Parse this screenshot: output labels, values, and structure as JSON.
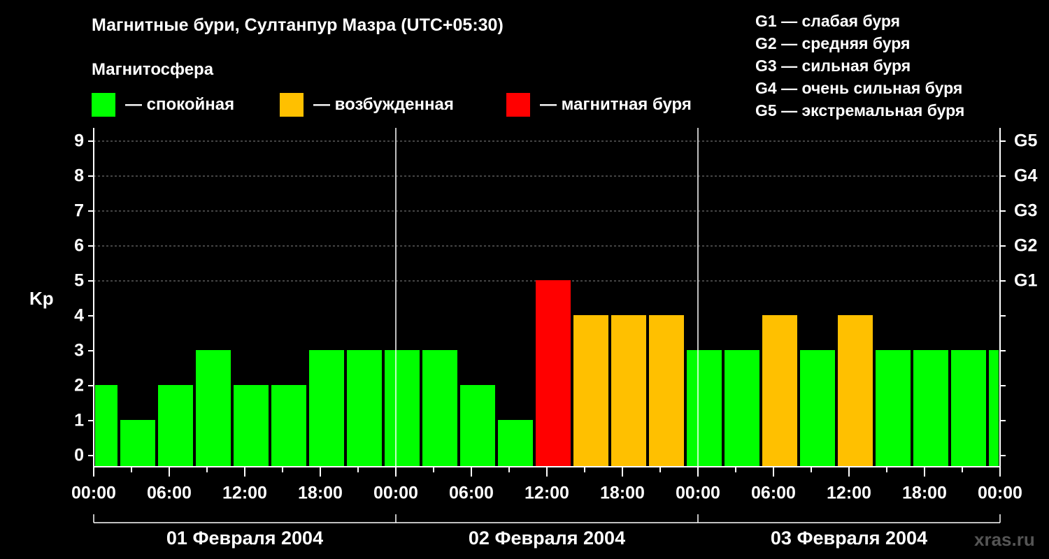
{
  "title": "Магнитные бури, Султанпур Мазра (UTC+05:30)",
  "subtitle": "Магнитосфера",
  "legend": [
    {
      "label": "— спокойная",
      "color": "#00ff00"
    },
    {
      "label": "— возбужденная",
      "color": "#ffc000"
    },
    {
      "label": "— магнитная буря",
      "color": "#ff0000"
    }
  ],
  "g_legend": [
    "G1 — слабая буря",
    "G2 — средняя буря",
    "G3 — сильная буря",
    "G4 — очень сильная буря",
    "G5 — экстремальная буря"
  ],
  "watermark": "xras.ru",
  "chart_data": {
    "type": "bar",
    "ylabel": "Kp",
    "ylim": [
      0,
      9
    ],
    "y_ticks": [
      "0",
      "1",
      "2",
      "3",
      "4",
      "5",
      "6",
      "7",
      "8",
      "9"
    ],
    "g_ticks": [
      {
        "kp": 5,
        "label": "G1"
      },
      {
        "kp": 6,
        "label": "G2"
      },
      {
        "kp": 7,
        "label": "G3"
      },
      {
        "kp": 8,
        "label": "G4"
      },
      {
        "kp": 9,
        "label": "G5"
      }
    ],
    "x_tick_labels": [
      "00:00",
      "06:00",
      "12:00",
      "18:00",
      "00:00",
      "06:00",
      "12:00",
      "18:00",
      "00:00",
      "06:00",
      "12:00",
      "18:00",
      "00:00"
    ],
    "days": [
      "01 Февраля 2004",
      "02 Февраля 2004",
      "03 Февраля 2004"
    ],
    "grid": true,
    "colors": {
      "quiet": "#00ff00",
      "active": "#ffc000",
      "storm": "#ff0000"
    },
    "bars": [
      {
        "start_hour": 0.0,
        "end_hour": 2.0,
        "kp": 2
      },
      {
        "start_hour": 2.0,
        "end_hour": 5.0,
        "kp": 1
      },
      {
        "start_hour": 5.0,
        "end_hour": 8.0,
        "kp": 2
      },
      {
        "start_hour": 8.0,
        "end_hour": 11.0,
        "kp": 3
      },
      {
        "start_hour": 11.0,
        "end_hour": 14.0,
        "kp": 2
      },
      {
        "start_hour": 14.0,
        "end_hour": 17.0,
        "kp": 2
      },
      {
        "start_hour": 17.0,
        "end_hour": 20.0,
        "kp": 3
      },
      {
        "start_hour": 20.0,
        "end_hour": 23.0,
        "kp": 3
      },
      {
        "start_hour": 23.0,
        "end_hour": 26.0,
        "kp": 3
      },
      {
        "start_hour": 26.0,
        "end_hour": 29.0,
        "kp": 3
      },
      {
        "start_hour": 29.0,
        "end_hour": 32.0,
        "kp": 2
      },
      {
        "start_hour": 32.0,
        "end_hour": 35.0,
        "kp": 1
      },
      {
        "start_hour": 35.0,
        "end_hour": 38.0,
        "kp": 5
      },
      {
        "start_hour": 38.0,
        "end_hour": 41.0,
        "kp": 4
      },
      {
        "start_hour": 41.0,
        "end_hour": 44.0,
        "kp": 4
      },
      {
        "start_hour": 44.0,
        "end_hour": 47.0,
        "kp": 4
      },
      {
        "start_hour": 47.0,
        "end_hour": 50.0,
        "kp": 3
      },
      {
        "start_hour": 50.0,
        "end_hour": 53.0,
        "kp": 3
      },
      {
        "start_hour": 53.0,
        "end_hour": 56.0,
        "kp": 4
      },
      {
        "start_hour": 56.0,
        "end_hour": 59.0,
        "kp": 3
      },
      {
        "start_hour": 59.0,
        "end_hour": 62.0,
        "kp": 4
      },
      {
        "start_hour": 62.0,
        "end_hour": 65.0,
        "kp": 3
      },
      {
        "start_hour": 65.0,
        "end_hour": 68.0,
        "kp": 3
      },
      {
        "start_hour": 68.0,
        "end_hour": 71.0,
        "kp": 3
      },
      {
        "start_hour": 71.0,
        "end_hour": 72.0,
        "kp": 3
      }
    ]
  }
}
